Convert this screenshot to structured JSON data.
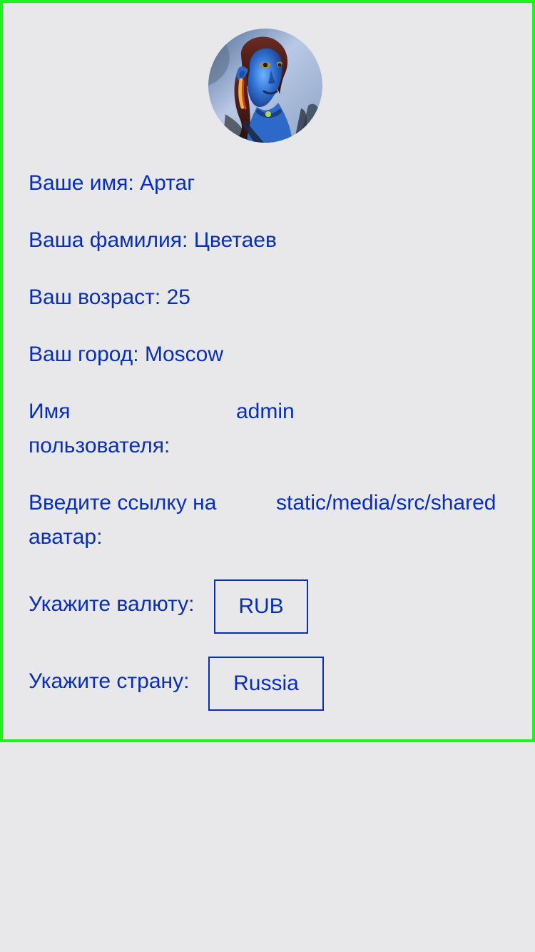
{
  "profile": {
    "name_label": "Ваше имя:",
    "name_value": "Артаг",
    "surname_label": "Ваша фамилия:",
    "surname_value": "Цветаев",
    "age_label": "Ваш возраст:",
    "age_value": "25",
    "city_label": "Ваш город:",
    "city_value": "Moscow",
    "username_label_line1": "Имя",
    "username_label_line2": "пользователя:",
    "username_value": "admin",
    "avatar_label_line1": "Введите ссылку на",
    "avatar_label_line2": "аватар:",
    "avatar_value": "static/media/src/shared",
    "currency_label": "Укажите валюту:",
    "currency_value": "RUB",
    "country_label": "Укажите страну:",
    "country_value": "Russia"
  },
  "colors": {
    "text": "#0a2fb7",
    "frame_border": "#1bf51b",
    "background": "#e8e8ea"
  }
}
